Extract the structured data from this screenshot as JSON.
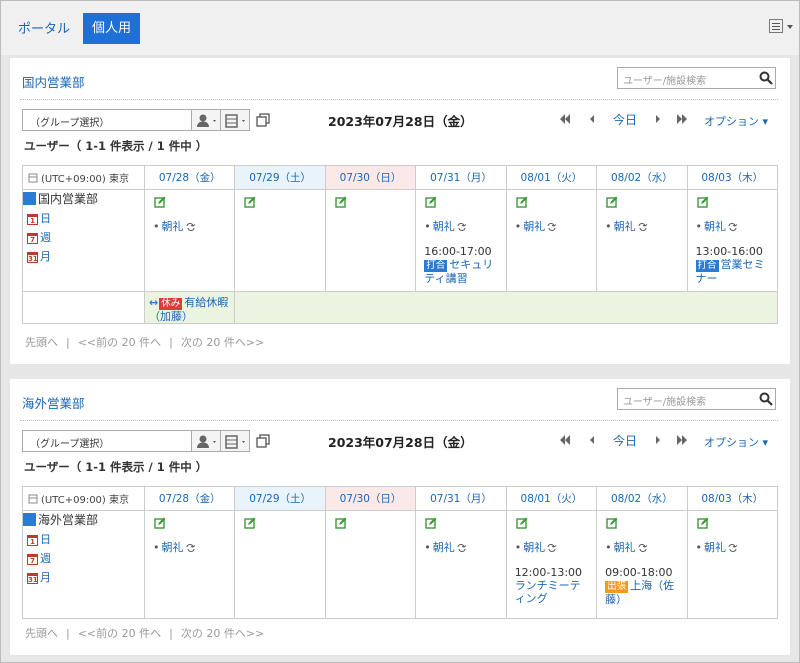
{
  "topbar": {
    "tab_portal": "ポータル",
    "tab_personal": "個人用"
  },
  "colors": {
    "accent": "#1e6fd6",
    "link": "#1a66b3",
    "meeting_badge": "#2a7bd4",
    "trip_badge": "#f39a1e",
    "off_badge": "#e03b3b"
  },
  "common": {
    "search_placeholder": "ユーザー/施設検索",
    "group_select": "（グループ選択）",
    "date_title": "2023年07月28日（金）",
    "today": "今日",
    "option": "オプション",
    "user_count": "ユーザー（ 1-1 件表示 / 1 件中 ）",
    "timezone": "(UTC+09:00) 東京",
    "days": [
      "07/28（金）",
      "07/29（土）",
      "07/30（日）",
      "07/31（月）",
      "08/01（火）",
      "08/02（水）",
      "08/03（木）"
    ],
    "view_day": "日",
    "view_week": "週",
    "view_month": "月",
    "pager_first": "先頭へ",
    "pager_prev": "<<前の 20 件へ",
    "pager_next": "次の 20 件へ>>",
    "pager_sep": "|"
  },
  "panels": [
    {
      "title": "国内営業部",
      "user": "国内営業部",
      "cells": [
        {
          "regular": "朝礼"
        },
        {},
        {},
        {
          "regular": "朝礼",
          "time": "16:00-17:00",
          "badge": "打合",
          "text": "セキュリティ講習"
        },
        {
          "regular": "朝礼"
        },
        {
          "regular": "朝礼"
        },
        {
          "regular": "朝礼",
          "time": "13:00-16:00",
          "badge": "打合",
          "text": "営業セミナー"
        }
      ],
      "allday": {
        "badge": "休み",
        "text": "有給休暇（加藤）"
      }
    },
    {
      "title": "海外営業部",
      "user": "海外営業部",
      "cells": [
        {
          "regular": "朝礼"
        },
        {},
        {},
        {
          "regular": "朝礼"
        },
        {
          "regular": "朝礼",
          "time": "12:00-13:00",
          "text": "ランチミーティング"
        },
        {
          "regular": "朝礼",
          "time": "09:00-18:00",
          "badge": "出張",
          "text": "上海（佐藤）"
        },
        {
          "regular": "朝礼"
        }
      ]
    }
  ]
}
